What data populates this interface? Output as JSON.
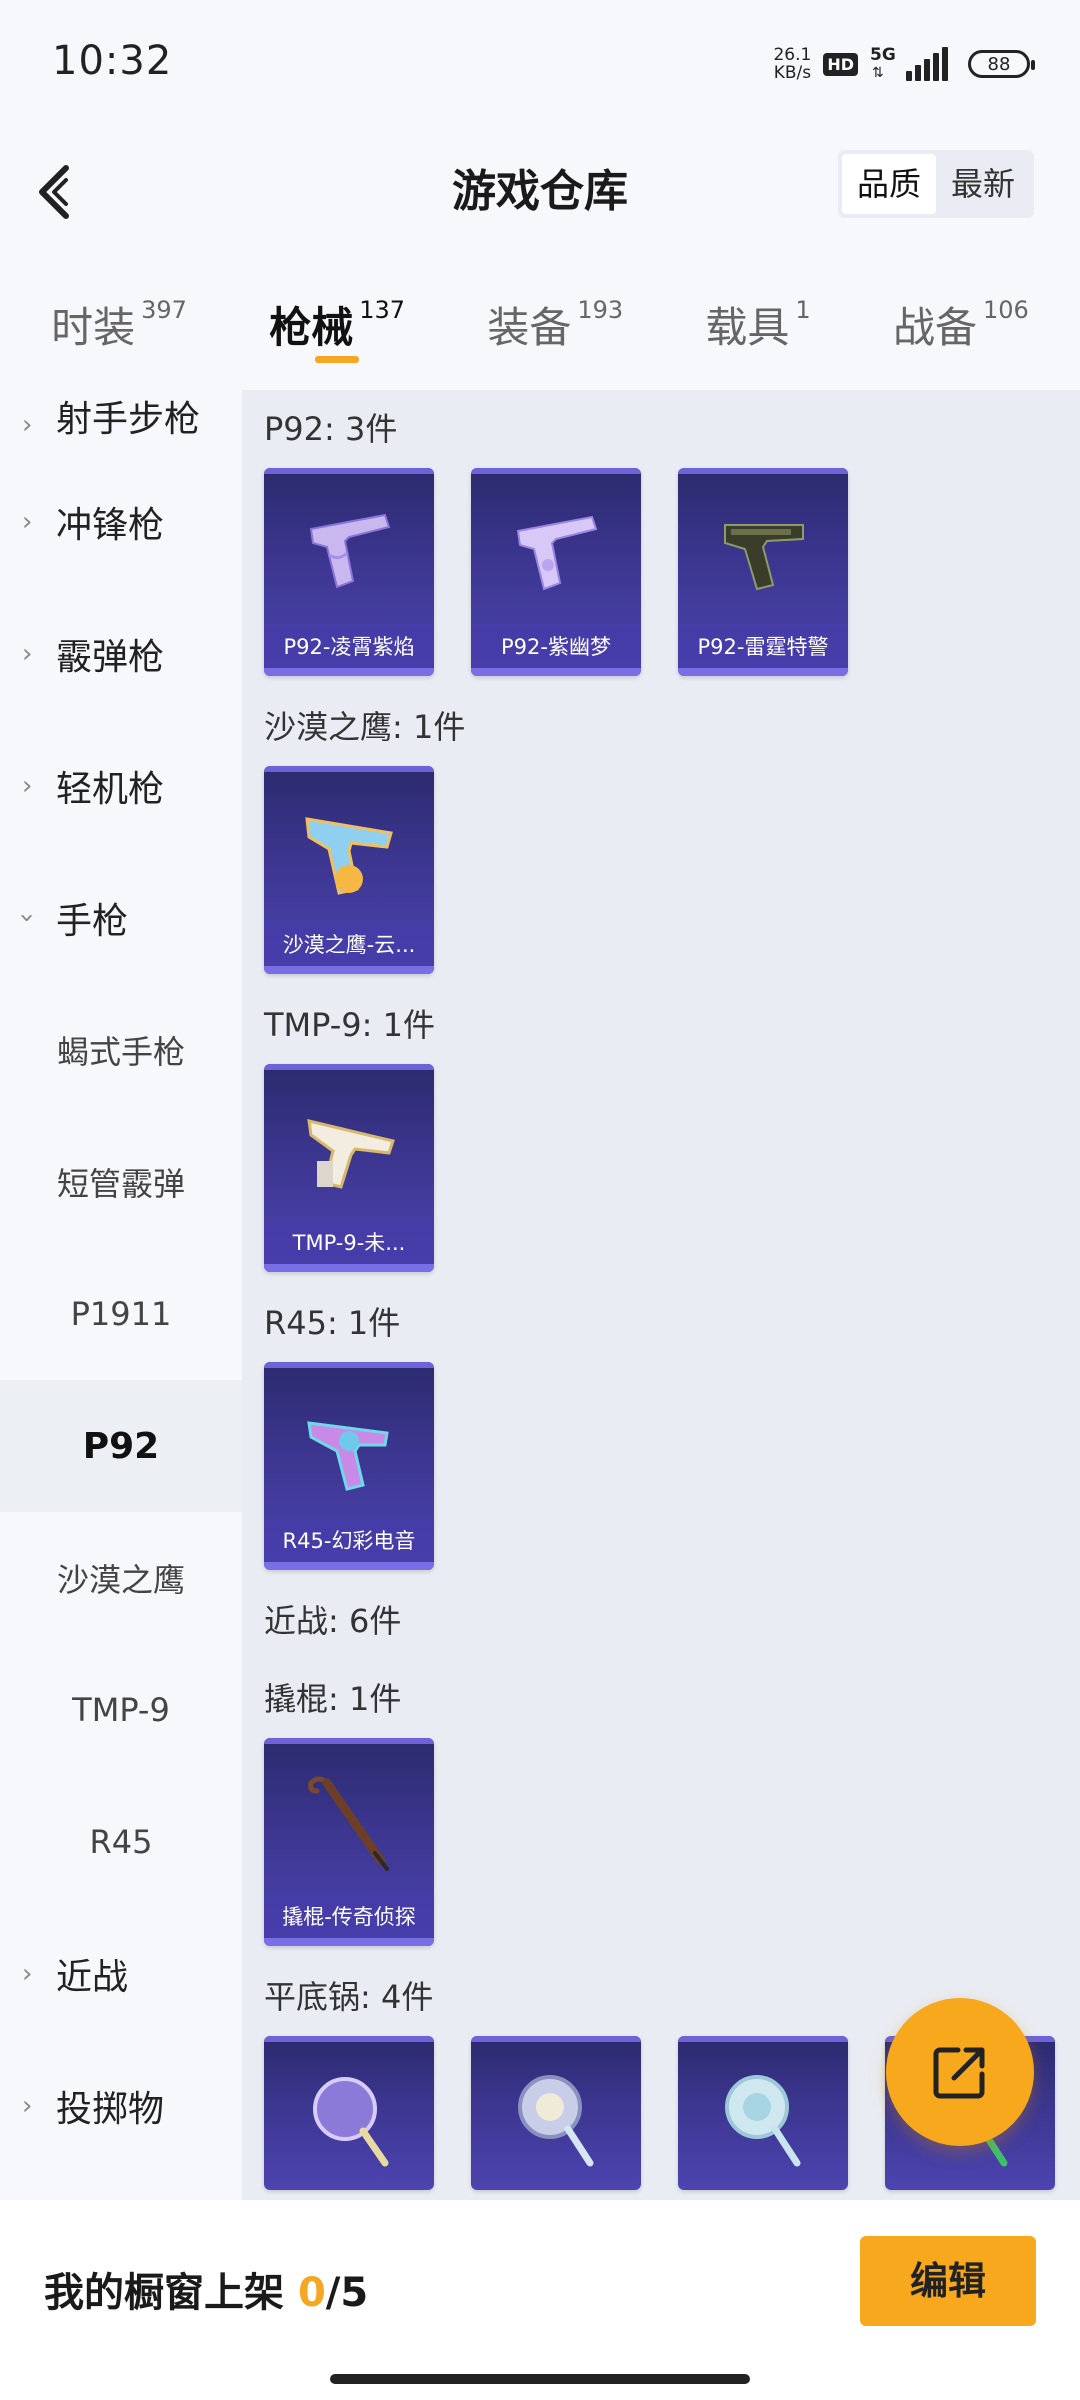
{
  "status": {
    "time": "10:32",
    "net_speed_value": "26.1",
    "net_speed_unit": "KB/s",
    "hd": "HD",
    "network": "5G",
    "battery": "88"
  },
  "header": {
    "title": "游戏仓库",
    "sort_options": [
      "品质",
      "最新"
    ],
    "sort_active": "品质"
  },
  "tabs": [
    {
      "label": "时装",
      "count": "397"
    },
    {
      "label": "枪械",
      "count": "137",
      "active": true
    },
    {
      "label": "装备",
      "count": "193"
    },
    {
      "label": "载具",
      "count": "1"
    },
    {
      "label": "战备",
      "count": "106"
    }
  ],
  "sidebar": {
    "items": [
      {
        "label": "射手步枪",
        "type": "group"
      },
      {
        "label": "冲锋枪",
        "type": "group"
      },
      {
        "label": "霰弹枪",
        "type": "group"
      },
      {
        "label": "轻机枪",
        "type": "group"
      },
      {
        "label": "手枪",
        "type": "group",
        "expanded": true
      },
      {
        "label": "蝎式手枪",
        "type": "sub"
      },
      {
        "label": "短管霰弹",
        "type": "sub"
      },
      {
        "label": "P1911",
        "type": "sub"
      },
      {
        "label": "P92",
        "type": "sub",
        "active": true
      },
      {
        "label": "沙漠之鹰",
        "type": "sub"
      },
      {
        "label": "TMP-9",
        "type": "sub"
      },
      {
        "label": "R45",
        "type": "sub"
      },
      {
        "label": "近战",
        "type": "group"
      },
      {
        "label": "投掷物",
        "type": "group"
      }
    ]
  },
  "sections": [
    {
      "title": "P92: 3件",
      "items": [
        "P92-凌霄紫焰",
        "P92-紫幽梦",
        "P92-雷霆特警"
      ]
    },
    {
      "title": "沙漠之鹰: 1件",
      "items": [
        "沙漠之鹰-云..."
      ]
    },
    {
      "title": "TMP-9: 1件",
      "items": [
        "TMP-9-未..."
      ]
    },
    {
      "title": "R45: 1件",
      "items": [
        "R45-幻彩电音"
      ]
    },
    {
      "title": "近战: 6件",
      "items": []
    },
    {
      "title": "撬棍: 1件",
      "items": [
        "撬棍-传奇侦探"
      ]
    },
    {
      "title": "平底锅: 4件",
      "items": [
        "",
        "",
        "",
        ""
      ]
    }
  ],
  "bottom": {
    "label": "我的橱窗上架",
    "current": "0",
    "total": "/5",
    "edit_label": "编辑"
  },
  "colors": {
    "accent": "#f7a81c",
    "card_bg": "#3c3690"
  },
  "icons": {
    "back": "chevron-left-icon",
    "fab": "share-out-icon"
  }
}
